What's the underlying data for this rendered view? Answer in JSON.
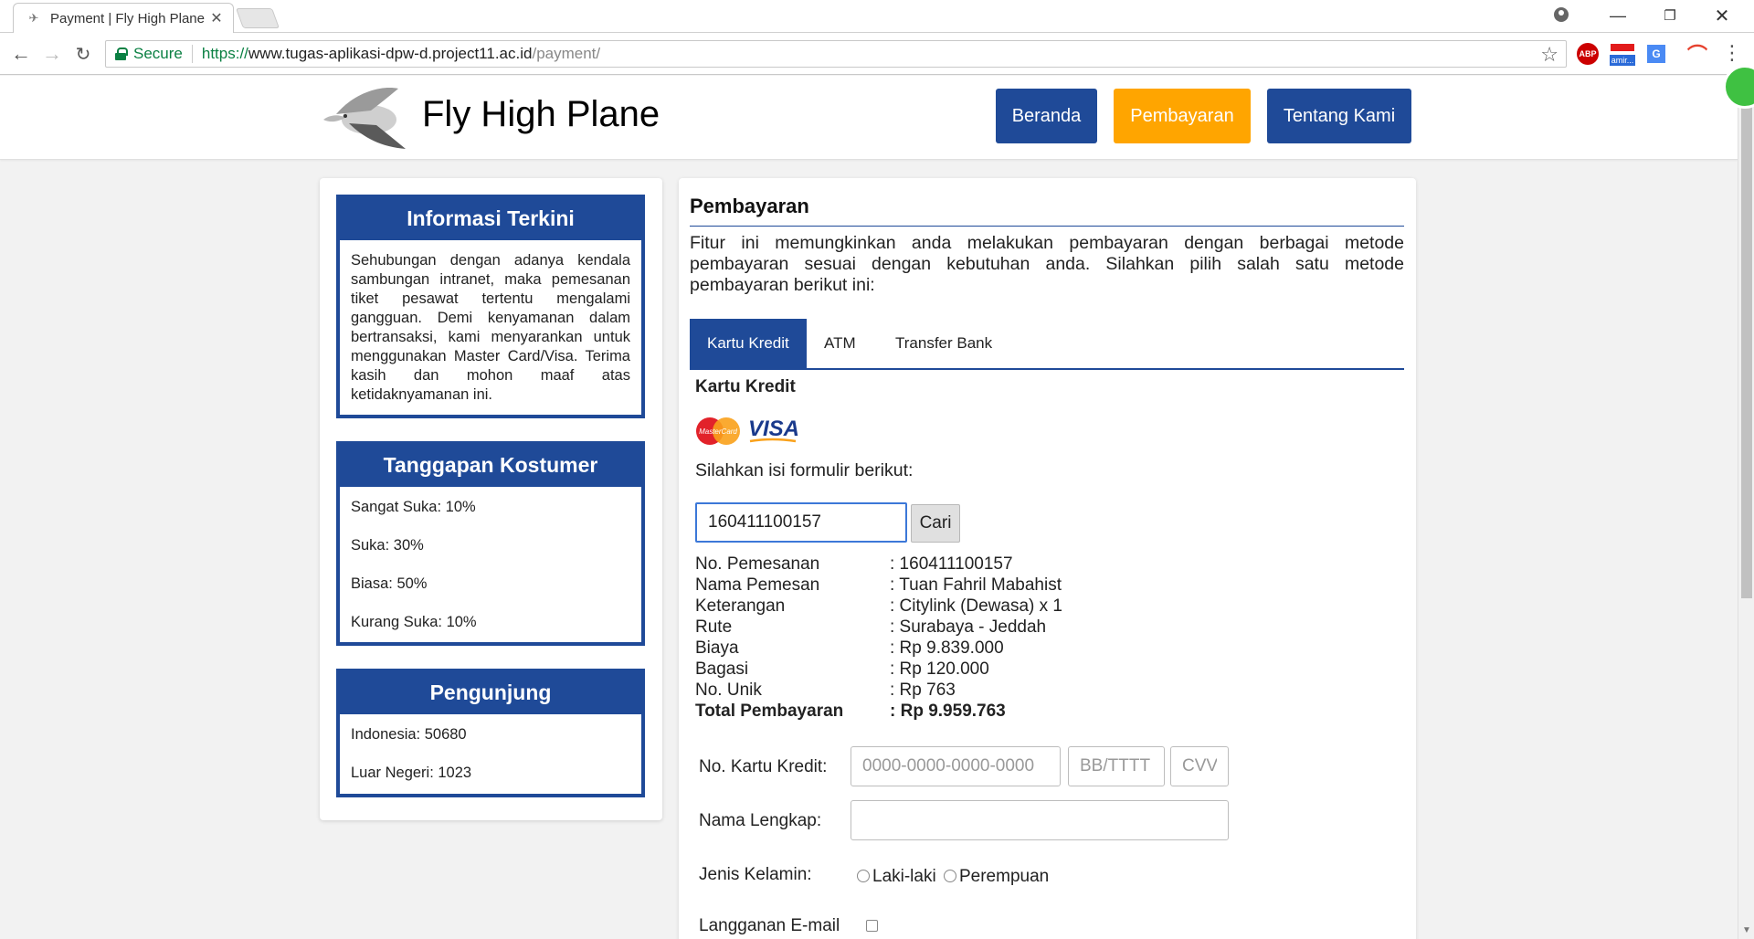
{
  "browser": {
    "tab_title": "Payment | Fly High Plane",
    "secure_label": "Secure",
    "url_scheme": "https://",
    "url_host": "www.tugas-aplikasi-dpw-d.project11.ac.id",
    "url_path": "/payment/",
    "ext_abp": "ABP",
    "ext_badge": "amir..."
  },
  "header": {
    "site_title": "Fly High Plane",
    "nav": {
      "beranda": "Beranda",
      "pembayaran": "Pembayaran",
      "tentang": "Tentang Kami"
    }
  },
  "sidebar": {
    "info": {
      "title": "Informasi Terkini",
      "text": "Sehubungan dengan adanya kendala sambungan intranet, maka pemesanan tiket pesawat tertentu mengalami gangguan. Demi kenyamanan dalam bertransaksi, kami menyarankan untuk menggunakan Master Card/Visa. Terima kasih dan mohon maaf atas ketidaknyamanan ini."
    },
    "responses": {
      "title": "Tanggapan Kostumer",
      "items": [
        "Sangat Suka: 10%",
        "Suka: 30%",
        "Biasa: 50%",
        "Kurang Suka: 10%"
      ]
    },
    "visitors": {
      "title": "Pengunjung",
      "items": [
        "Indonesia: 50680",
        "Luar Negeri: 1023"
      ]
    }
  },
  "main": {
    "title": "Pembayaran",
    "intro": "Fitur ini memungkinkan anda melakukan pembayaran dengan berbagai metode pembayaran sesuai dengan kebutuhan anda. Silahkan pilih salah satu metode pembayaran berikut ini:",
    "tabs": [
      "Kartu Kredit",
      "ATM",
      "Transfer Bank"
    ],
    "active_tab": "Kartu Kredit",
    "section_title": "Kartu Kredit",
    "mastercard_text": "MasterCard",
    "visa_text": "VISA",
    "fill_prompt": "Silahkan isi formulir berikut:",
    "search_value": "160411100157",
    "search_button": "Cari",
    "details": [
      {
        "label": "No. Pemesanan",
        "value": ": 160411100157"
      },
      {
        "label": "Nama Pemesan",
        "value": ": Tuan Fahril Mabahist"
      },
      {
        "label": "Keterangan",
        "value": ": Citylink (Dewasa) x 1"
      },
      {
        "label": "Rute",
        "value": ": Surabaya - Jeddah"
      },
      {
        "label": "Biaya",
        "value": ": Rp 9.839.000"
      },
      {
        "label": "Bagasi",
        "value": ": Rp 120.000"
      },
      {
        "label": "No. Unik",
        "value": ": Rp 763"
      },
      {
        "label": "Total Pembayaran",
        "value": ": Rp 9.959.763"
      }
    ],
    "form": {
      "card_label": "No. Kartu Kredit:",
      "card_placeholder": "0000-0000-0000-0000",
      "expiry_placeholder": "BB/TTTT",
      "cvv_placeholder": "CVV",
      "name_label": "Nama Lengkap:",
      "name_value": "",
      "gender_label": "Jenis Kelamin:",
      "gender_male": "Laki-laki",
      "gender_female": "Perempuan",
      "newsletter_label": "Langganan E-mail"
    }
  },
  "colors": {
    "primary": "#1f4a98",
    "accent": "#ffa500",
    "secure_green": "#0b8043"
  }
}
